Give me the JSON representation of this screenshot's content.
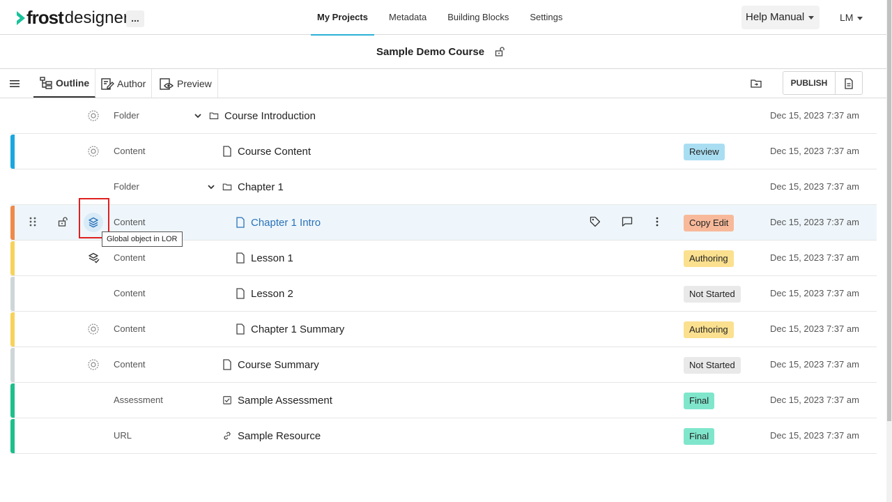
{
  "app": {
    "logo_frost": "frost",
    "logo_designer": "designer",
    "more": "...",
    "nav": [
      {
        "label": "My Projects"
      },
      {
        "label": "Metadata"
      },
      {
        "label": "Building Blocks"
      },
      {
        "label": "Settings"
      }
    ],
    "help": "Help Manual",
    "user": "LM"
  },
  "course": {
    "title": "Sample Demo Course"
  },
  "toolbar": {
    "tabs": [
      {
        "label": "Outline"
      },
      {
        "label": "Author"
      },
      {
        "label": "Preview"
      }
    ],
    "publish": "PUBLISH"
  },
  "colors": {
    "accent": "#2bb0d8",
    "review": "#a9def2",
    "copy_edit": "#f8b99a",
    "authoring": "#fbe08f",
    "not_started": "#e9e9e9",
    "final": "#7fe6cc",
    "bar_blue": "#1aa7e0",
    "bar_orange": "#f08a4b",
    "bar_yellow": "#f7d25b",
    "bar_grey": "#cfd6d8",
    "bar_green": "#1dbf8a"
  },
  "rows": [
    {
      "type": "Folder",
      "title": "Course Introduction",
      "status": "",
      "date": "Dec 15, 2023 7:37 am"
    },
    {
      "type": "Content",
      "title": "Course Content",
      "status": "Review",
      "date": "Dec 15, 2023 7:37 am"
    },
    {
      "type": "Folder",
      "title": "Chapter 1",
      "status": "",
      "date": "Dec 15, 2023 7:37 am"
    },
    {
      "type": "Content",
      "title": "Chapter 1 Intro",
      "status": "Copy Edit",
      "date": "Dec 15, 2023 7:37 am"
    },
    {
      "type": "Content",
      "title": "Lesson 1",
      "status": "Authoring",
      "date": "Dec 15, 2023 7:37 am"
    },
    {
      "type": "Content",
      "title": "Lesson 2",
      "status": "Not Started",
      "date": "Dec 15, 2023 7:37 am"
    },
    {
      "type": "Content",
      "title": "Chapter 1 Summary",
      "status": "Authoring",
      "date": "Dec 15, 2023 7:37 am"
    },
    {
      "type": "Content",
      "title": "Course Summary",
      "status": "Not Started",
      "date": "Dec 15, 2023 7:37 am"
    },
    {
      "type": "Assessment",
      "title": "Sample Assessment",
      "status": "Final",
      "date": "Dec 15, 2023 7:37 am"
    },
    {
      "type": "URL",
      "title": "Sample Resource",
      "status": "Final",
      "date": "Dec 15, 2023 7:37 am"
    }
  ],
  "tooltip": "Global object in LOR"
}
